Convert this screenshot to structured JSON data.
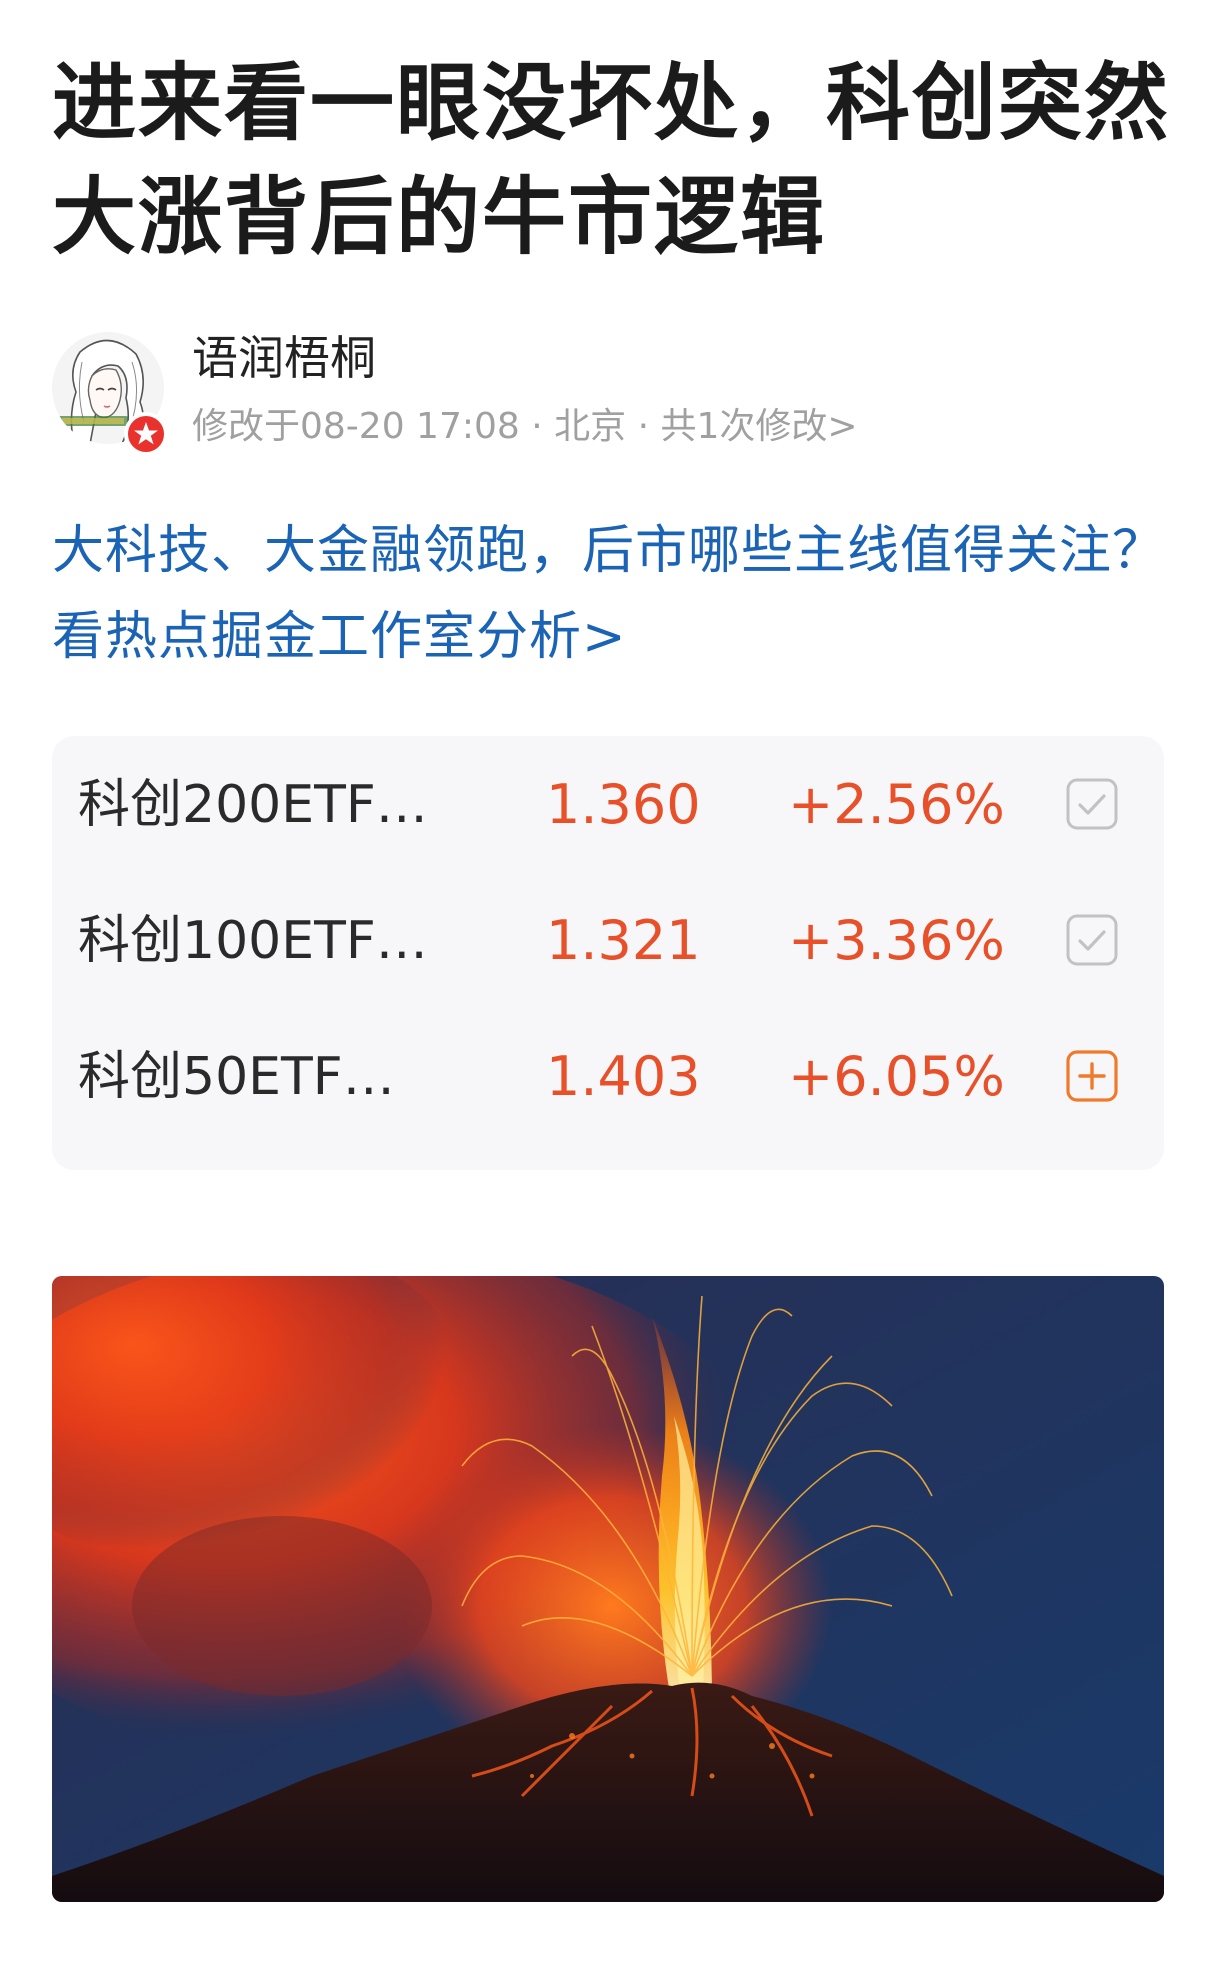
{
  "article": {
    "title": "进来看一眼没坏处，科创突然大涨背后的牛市逻辑"
  },
  "author": {
    "name": "语润梧桐",
    "meta": "修改于08-20 17:08 · 北京 · 共1次修改>",
    "avatar_icon": "avatar-illustration",
    "badge_icon": "star-icon",
    "badge_color": "#e9322e"
  },
  "promo": {
    "text": "大科技、大金融领跑，后市哪些主线值得关注？看热点掘金工作室分析>",
    "color": "#1a63b5"
  },
  "quotes": [
    {
      "name": "科创200ETF…",
      "price": "1.360",
      "change": "+2.56%",
      "action_icon": "check-icon",
      "added": true
    },
    {
      "name": "科创100ETF…",
      "price": "1.321",
      "change": "+3.36%",
      "action_icon": "check-icon",
      "added": true
    },
    {
      "name": "科创50ETF…",
      "price": "1.403",
      "change": "+6.05%",
      "action_icon": "plus-icon",
      "added": false
    }
  ],
  "colors": {
    "up": "#e8502a",
    "card_bg": "#f7f7f9",
    "check_gray": "#c2c2c2",
    "add_orange": "#f07a2a"
  },
  "image": {
    "subject": "erupting-volcano"
  }
}
